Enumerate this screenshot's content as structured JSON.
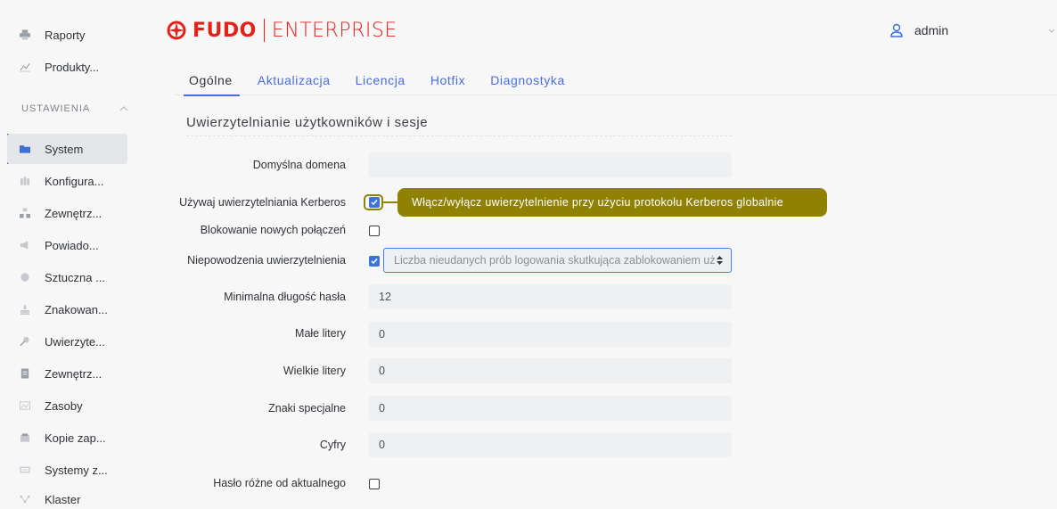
{
  "colors": {
    "brand": "#e2231a",
    "accent": "#4a6fdc",
    "callout": "#8f8200"
  },
  "sidebar": {
    "items_top": [
      {
        "label": "Raporty",
        "icon": "printer-icon"
      },
      {
        "label": "Produkty...",
        "icon": "chart-icon"
      }
    ],
    "section_header": "USTAWIENIA",
    "items": [
      {
        "label": "System",
        "icon": "folder-icon",
        "active": true
      },
      {
        "label": "Konfigura...",
        "icon": "grid-icon"
      },
      {
        "label": "Zewnętrz...",
        "icon": "network-icon"
      },
      {
        "label": "Powiado...",
        "icon": "megaphone-icon"
      },
      {
        "label": "Sztuczna ...",
        "icon": "brain-icon"
      },
      {
        "label": "Znakowan...",
        "icon": "stamp-icon"
      },
      {
        "label": "Uwierzyte...",
        "icon": "key-icon"
      },
      {
        "label": "Zewnętrz...",
        "icon": "document-icon"
      },
      {
        "label": "Zasoby",
        "icon": "image-icon"
      },
      {
        "label": "Kopie zap...",
        "icon": "archive-icon"
      },
      {
        "label": "Systemy z...",
        "icon": "server-icon"
      },
      {
        "label": "Klaster",
        "icon": "cluster-icon"
      }
    ]
  },
  "header": {
    "logo_brand": "FUDO",
    "logo_product": "ENTERPRISE",
    "user": "admin"
  },
  "tabs": [
    {
      "label": "Ogólne",
      "active": true
    },
    {
      "label": "Aktualizacja"
    },
    {
      "label": "Licencja"
    },
    {
      "label": "Hotfix"
    },
    {
      "label": "Diagnostyka"
    }
  ],
  "section_title": "Uwierzytelnianie użytkowników i sesje",
  "form": {
    "default_domain": {
      "label": "Domyślna domena",
      "value": ""
    },
    "kerberos": {
      "label": "Używaj uwierzytelniania Kerberos",
      "checked": true
    },
    "callout": "Włącz/wyłącz uwierzytelnienie przy użyciu protokołu Kerberos globalnie",
    "block_new": {
      "label": "Blokowanie nowych połączeń",
      "checked": false
    },
    "auth_failures": {
      "label": "Niepowodzenia uwierzytelnienia",
      "checked": true,
      "select_value": "Liczba nieudanych prób logowania skutkująca zablokowaniem użytkownika"
    },
    "min_length": {
      "label": "Minimalna długość hasła",
      "value": "12"
    },
    "lowercase": {
      "label": "Małe litery",
      "value": "0"
    },
    "uppercase": {
      "label": "Wielkie litery",
      "value": "0"
    },
    "special": {
      "label": "Znaki specjalne",
      "value": "0"
    },
    "digits": {
      "label": "Cyfry",
      "value": "0"
    },
    "differ_current": {
      "label": "Hasło różne od aktualnego",
      "checked": false
    }
  }
}
